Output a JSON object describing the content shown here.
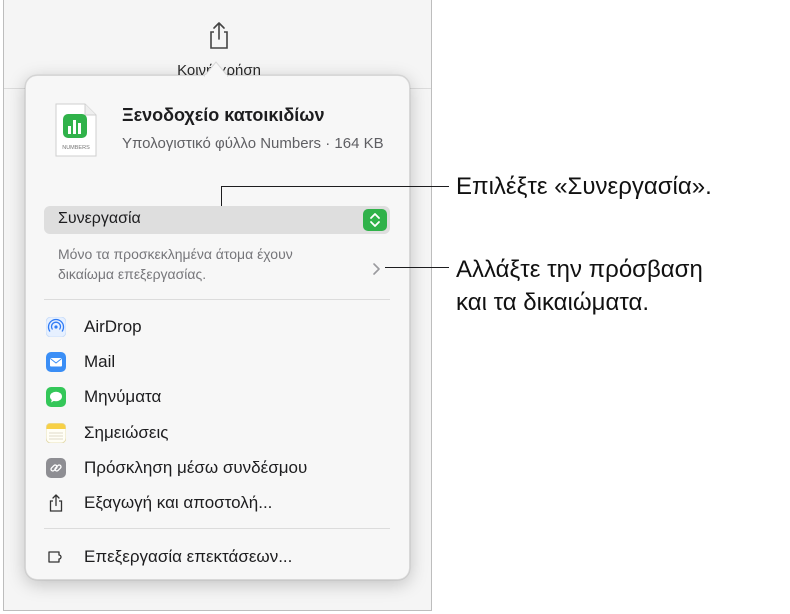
{
  "toolbar": {
    "share_label": "Κοινή χρήση",
    "share_icon": "share-icon"
  },
  "document": {
    "title": "Ξενοδοχείο κατοικιδίων",
    "subtitle": "Υπολογιστικό φύλλο Numbers · 164 KB",
    "icon_label": "NUMBERS",
    "icon_name": "numbers-document-icon"
  },
  "collaboration": {
    "selected": "Συνεργασία",
    "access_text": "Μόνο τα προσκεκλημένα άτομα έχουν δικαίωμα επεξεργασίας."
  },
  "menu": {
    "items": [
      {
        "label": "AirDrop",
        "icon": "airdrop-icon"
      },
      {
        "label": "Mail",
        "icon": "mail-icon"
      },
      {
        "label": "Μηνύματα",
        "icon": "messages-icon"
      },
      {
        "label": "Σημειώσεις",
        "icon": "notes-icon"
      },
      {
        "label": "Πρόσκληση μέσω συνδέσμου",
        "icon": "link-icon"
      },
      {
        "label": "Εξαγωγή και αποστολή...",
        "icon": "export-icon"
      }
    ],
    "extensions": {
      "label": "Επεξεργασία επεκτάσεων...",
      "icon": "extensions-icon"
    }
  },
  "callouts": {
    "collab": "Επιλέξτε «Συνεργασία».",
    "access_line1": "Αλλάξτε την πρόσβαση",
    "access_line2": "και τα δικαιώματα."
  },
  "colors": {
    "accent_green": "#30b24a",
    "mail_blue": "#3a8ef6",
    "messages_green": "#34c759",
    "notes_yellow": "#f7d046"
  }
}
